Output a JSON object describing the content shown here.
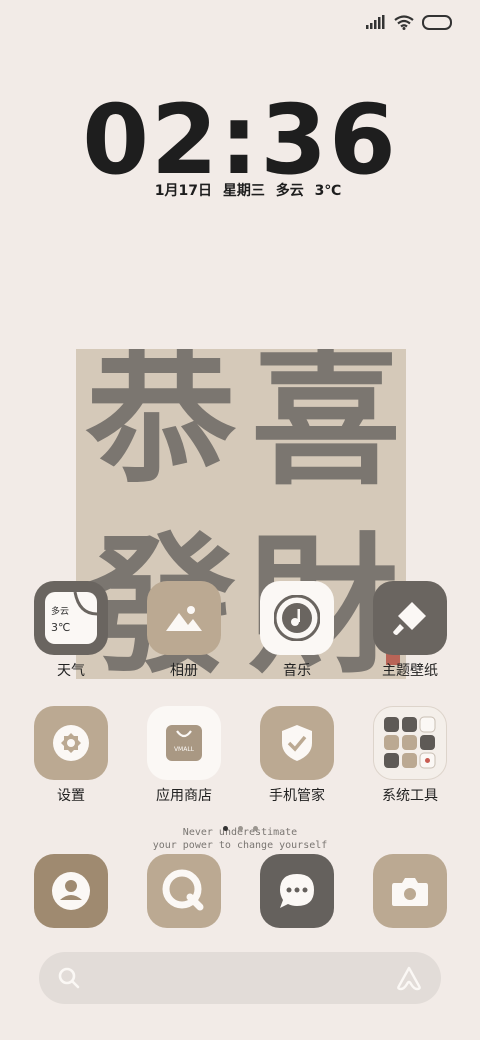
{
  "colors": {
    "background": "#f2ebe7",
    "dark_gray": "#6a6560",
    "tan": "#bba992",
    "light_tan": "#d5c9b9",
    "white_card": "#fbf8f5"
  },
  "lock": {
    "time": "02:36",
    "date": "1月17日 星期三 多云 3℃"
  },
  "artwork": {
    "glyph_top_left": "恭",
    "glyph_top_right": "喜",
    "glyph_bottom_left": "發",
    "glyph_bottom_right": "財"
  },
  "widget": {
    "condition": "多云",
    "temp": "3℃"
  },
  "apps_row1": [
    {
      "label": "天气",
      "icon": "weather-widget-icon"
    },
    {
      "label": "相册",
      "icon": "mountain-photo-icon"
    },
    {
      "label": "音乐",
      "icon": "music-disc-icon"
    },
    {
      "label": "主题壁纸",
      "icon": "paint-brush-icon"
    }
  ],
  "apps_row2": [
    {
      "label": "设置",
      "icon": "gear-icon"
    },
    {
      "label": "应用商店",
      "icon": "shopping-bag-icon",
      "badge": "VMALL"
    },
    {
      "label": "手机管家",
      "icon": "shield-check-icon"
    },
    {
      "label": "系统工具",
      "icon": "folder-grid-icon"
    }
  ],
  "motto": {
    "line1": "Never underestimate",
    "line2": "your power to change yourself"
  },
  "dock": [
    {
      "icon": "contacts-icon"
    },
    {
      "icon": "browser-icon"
    },
    {
      "icon": "message-icon"
    },
    {
      "icon": "camera-icon"
    }
  ]
}
